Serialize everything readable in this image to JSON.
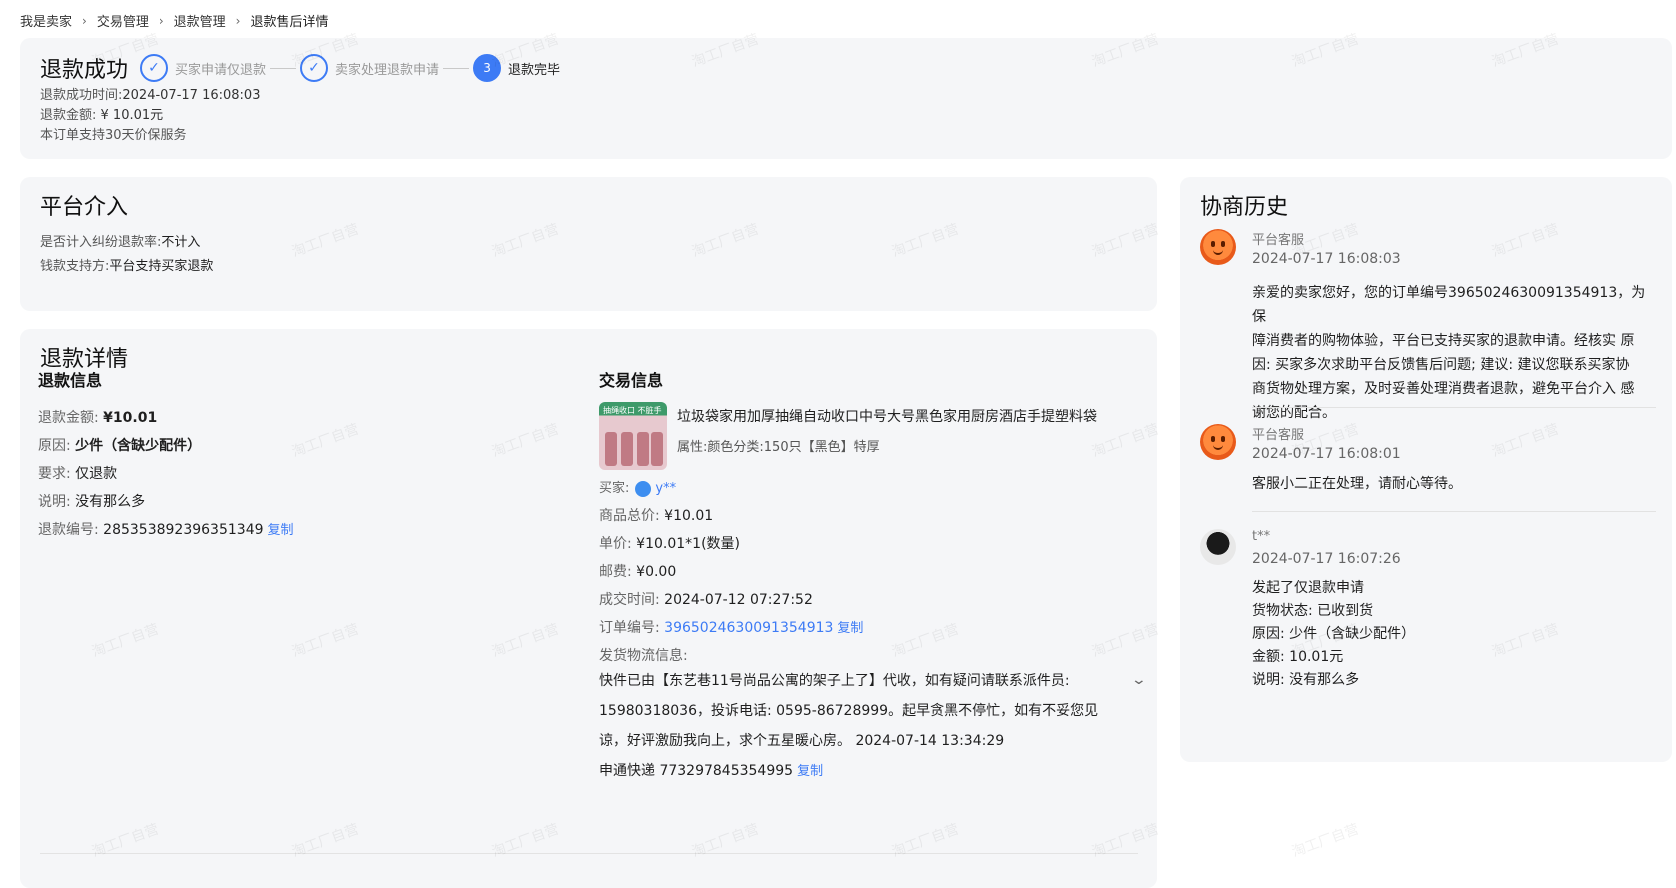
{
  "breadcrumb": [
    "我是卖家",
    "交易管理",
    "退款管理",
    "退款售后详情"
  ],
  "status": {
    "title": "退款成功",
    "steps": [
      {
        "label": "买家申请仅退款",
        "state": "done"
      },
      {
        "label": "卖家处理退款申请",
        "state": "done"
      },
      {
        "label": "退款完毕",
        "state": "active",
        "number": "3"
      }
    ],
    "success_time_label": "退款成功时间:",
    "success_time": "2024-07-17 16:08:03",
    "amount_label": "退款金额:",
    "amount": "¥ 10.01元",
    "price_protection": "本订单支持30天价保服务"
  },
  "platform": {
    "title": "平台介入",
    "dispute_label": "是否计入纠纷退款率:",
    "dispute_value": "不计入",
    "payer_label": "钱款支持方:",
    "payer_value": "平台支持买家退款"
  },
  "detail": {
    "title": "退款详情",
    "refund_info": {
      "title": "退款信息",
      "amount_label": "退款金额:",
      "amount": "¥10.01",
      "reason_label": "原因:",
      "reason": "少件（含缺少配件）",
      "request_label": "要求:",
      "request": "仅退款",
      "note_label": "说明:",
      "note": "没有那么多",
      "refund_no_label": "退款编号:",
      "refund_no": "285353892396351349",
      "copy": "复制"
    },
    "trade_info": {
      "title": "交易信息",
      "product_title": "垃圾袋家用加厚抽绳自动收口中号大号黑色家用厨房酒店手提塑料袋",
      "attr_label": "属性:",
      "attr": "颜色分类:150只【黑色】特厚",
      "product_img_tag": "抽绳收口 不脏手",
      "buyer_label": "买家:",
      "buyer": "y**",
      "total_label": "商品总价:",
      "total": "¥10.01",
      "unit_label": "单价:",
      "unit": "¥10.01*1(数量)",
      "postage_label": "邮费:",
      "postage": "¥0.00",
      "deal_time_label": "成交时间:",
      "deal_time": "2024-07-12 07:27:52",
      "order_no_label": "订单编号:",
      "order_no": "3965024630091354913",
      "copy": "复制",
      "logistics_label": "发货物流信息:",
      "logistics_line1": "快件已由【东艺巷11号尚品公寓的架子上了】代收，如有疑问请联系派件员:",
      "logistics_line2": "15980318036，投诉电话: 0595-86728999。起早贪黑不停忙，如有不妥您见",
      "logistics_line3": "谅，好评激励我向上，求个五星暖心房。 2024-07-14 13:34:29",
      "tracking_label": "申通快递",
      "tracking_no": "773297845354995",
      "tracking_copy": "复制"
    }
  },
  "history": {
    "title": "协商历史",
    "entries": [
      {
        "name": "平台客服",
        "time": "2024-07-17 16:08:03",
        "lines": [
          "亲爱的卖家您好，您的订单编号3965024630091354913，为保",
          "障消费者的购物体验，平台已支持买家的退款申请。经核实 原",
          "因: 买家多次求助平台反馈售后问题; 建议: 建议您联系买家协",
          "商货物处理方案，及时妥善处理消费者退款，避免平台介入   感",
          "谢您的配合。"
        ]
      },
      {
        "name": "平台客服",
        "time": "2024-07-17 16:08:01",
        "lines": [
          "客服小二正在处理，请耐心等待。"
        ]
      },
      {
        "name": "t**",
        "time": "2024-07-17 16:07:26",
        "lines": [
          "发起了仅退款申请",
          "货物状态:  已收到货",
          "原因:  少件（含缺少配件）",
          "金额:  10.01元",
          "说明:  没有那么多"
        ]
      }
    ]
  },
  "watermark_text": "淘工厂自营",
  "colors": {
    "accent": "#3d7bf5",
    "card_bg": "#f5f6f8"
  }
}
